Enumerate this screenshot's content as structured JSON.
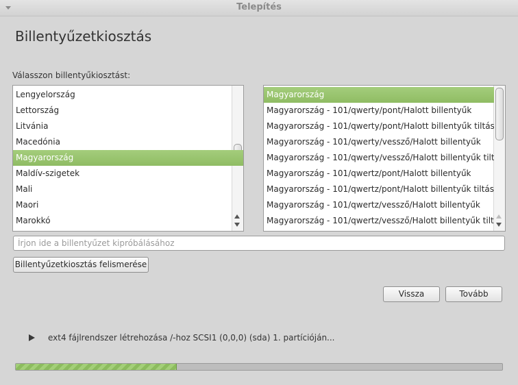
{
  "window": {
    "title": "Telepítés"
  },
  "page_title": "Billentyűzetkiosztás",
  "prompt": "Válasszon billentyűkiosztást:",
  "countries": {
    "items": [
      "Lengyelország",
      "Lettország",
      "Litvánia",
      "Macedónia",
      "Magyarország",
      "Maldív-szigetek",
      "Mali",
      "Maori",
      "Marokkó"
    ],
    "selected": "Magyarország"
  },
  "variants": {
    "items": [
      "Magyarország",
      "Magyarország - 101/qwerty/pont/Halott billentyűk",
      "Magyarország - 101/qwerty/pont/Halott billentyűk tiltás",
      "Magyarország - 101/qwerty/vessző/Halott billentyűk",
      "Magyarország - 101/qwerty/vessző/Halott billentyűk tilt",
      "Magyarország - 101/qwertz/pont/Halott billentyűk",
      "Magyarország - 101/qwertz/pont/Halott billentyűk tiltás",
      "Magyarország - 101/qwertz/vessző/Halott billentyűk",
      "Magyarország - 101/qwertz/vessző/Halott billentyűk tilt"
    ],
    "selected": "Magyarország"
  },
  "test_input": {
    "placeholder": "Írjon ide a billentyűzet kipróbálásához",
    "value": ""
  },
  "buttons": {
    "detect": "Billentyűzetkiosztás felismerése",
    "back": "Vissza",
    "next": "Tovább"
  },
  "status": {
    "text": "ext4 fájlrendszer létrehozása /-hoz SCSI1 (0,0,0) (sda) 1. partícióján...",
    "progress_fraction": 0.33
  },
  "colors": {
    "selection": "#98c46e",
    "background": "#d6d6d6"
  },
  "icons": [
    "window-menu-icon",
    "scroll-up-arrow-icon",
    "scroll-down-arrow-icon",
    "expander-arrow-icon"
  ]
}
